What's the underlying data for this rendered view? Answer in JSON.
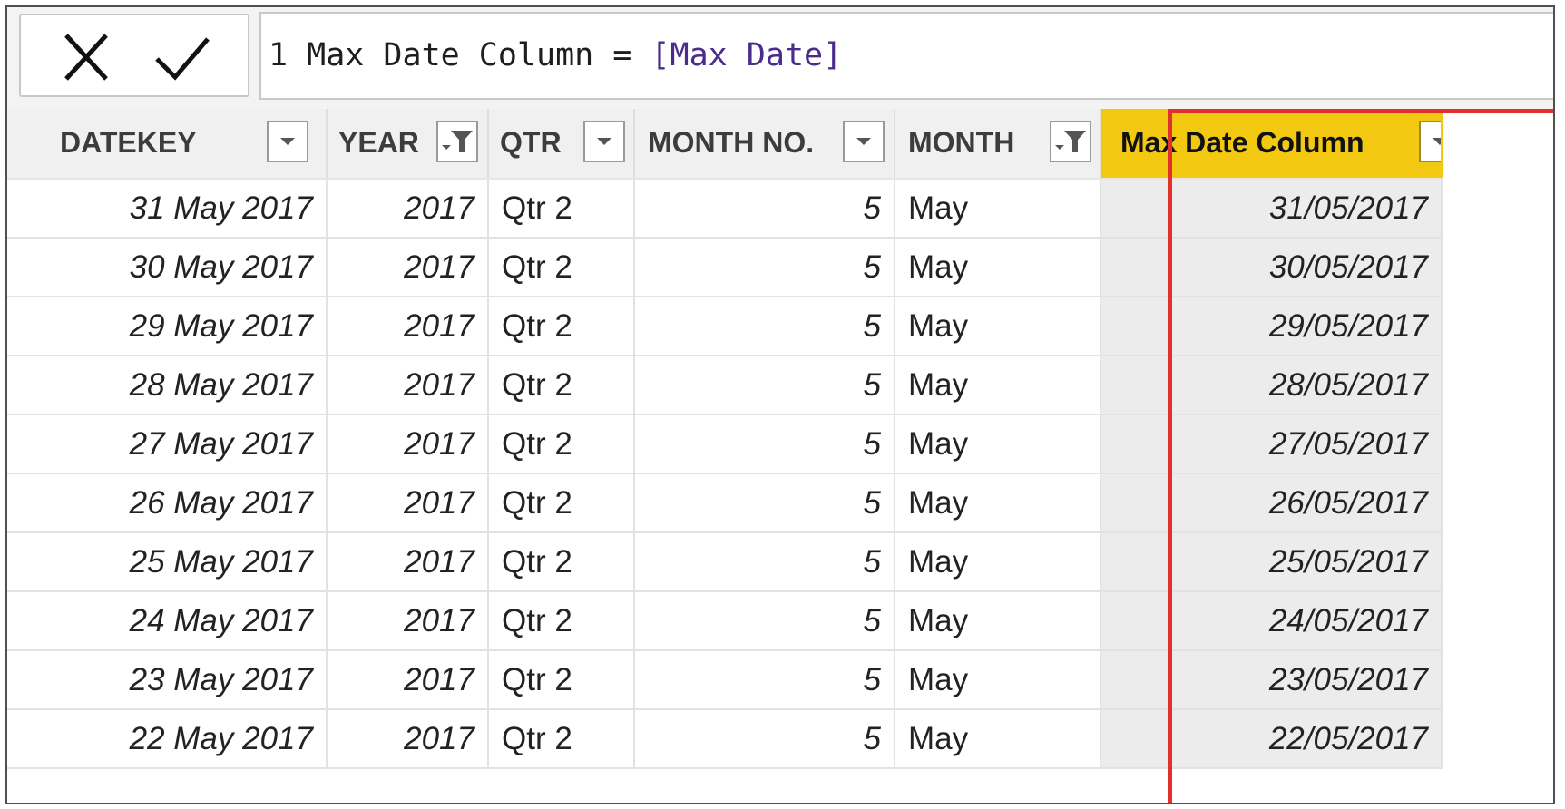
{
  "formula_bar": {
    "line_number": "1",
    "expression_prefix": " Max Date Column = ",
    "expression_ref": "[Max Date]",
    "cancel_icon": "close-icon",
    "commit_icon": "check-icon"
  },
  "columns": [
    {
      "label": "DATEKEY",
      "filtered": false
    },
    {
      "label": "YEAR",
      "filtered": true
    },
    {
      "label": "QTR",
      "filtered": false
    },
    {
      "label": "MONTH NO.",
      "filtered": false
    },
    {
      "label": "MONTH",
      "filtered": true
    },
    {
      "label": "Max Date Column",
      "filtered": false,
      "highlighted": true
    }
  ],
  "rows": [
    {
      "datekey": "31 May 2017",
      "year": "2017",
      "qtr": "Qtr 2",
      "month_no": "5",
      "month": "May",
      "max_date": "31/05/2017"
    },
    {
      "datekey": "30 May 2017",
      "year": "2017",
      "qtr": "Qtr 2",
      "month_no": "5",
      "month": "May",
      "max_date": "30/05/2017"
    },
    {
      "datekey": "29 May 2017",
      "year": "2017",
      "qtr": "Qtr 2",
      "month_no": "5",
      "month": "May",
      "max_date": "29/05/2017"
    },
    {
      "datekey": "28 May 2017",
      "year": "2017",
      "qtr": "Qtr 2",
      "month_no": "5",
      "month": "May",
      "max_date": "28/05/2017"
    },
    {
      "datekey": "27 May 2017",
      "year": "2017",
      "qtr": "Qtr 2",
      "month_no": "5",
      "month": "May",
      "max_date": "27/05/2017"
    },
    {
      "datekey": "26 May 2017",
      "year": "2017",
      "qtr": "Qtr 2",
      "month_no": "5",
      "month": "May",
      "max_date": "26/05/2017"
    },
    {
      "datekey": "25 May 2017",
      "year": "2017",
      "qtr": "Qtr 2",
      "month_no": "5",
      "month": "May",
      "max_date": "25/05/2017"
    },
    {
      "datekey": "24 May 2017",
      "year": "2017",
      "qtr": "Qtr 2",
      "month_no": "5",
      "month": "May",
      "max_date": "24/05/2017"
    },
    {
      "datekey": "23 May 2017",
      "year": "2017",
      "qtr": "Qtr 2",
      "month_no": "5",
      "month": "May",
      "max_date": "23/05/2017"
    },
    {
      "datekey": "22 May 2017",
      "year": "2017",
      "qtr": "Qtr 2",
      "month_no": "5",
      "month": "May",
      "max_date": "22/05/2017"
    }
  ],
  "colors": {
    "highlight_header": "#f2c811",
    "highlight_border": "#e0322b",
    "measure_ref": "#4b2c8c"
  }
}
